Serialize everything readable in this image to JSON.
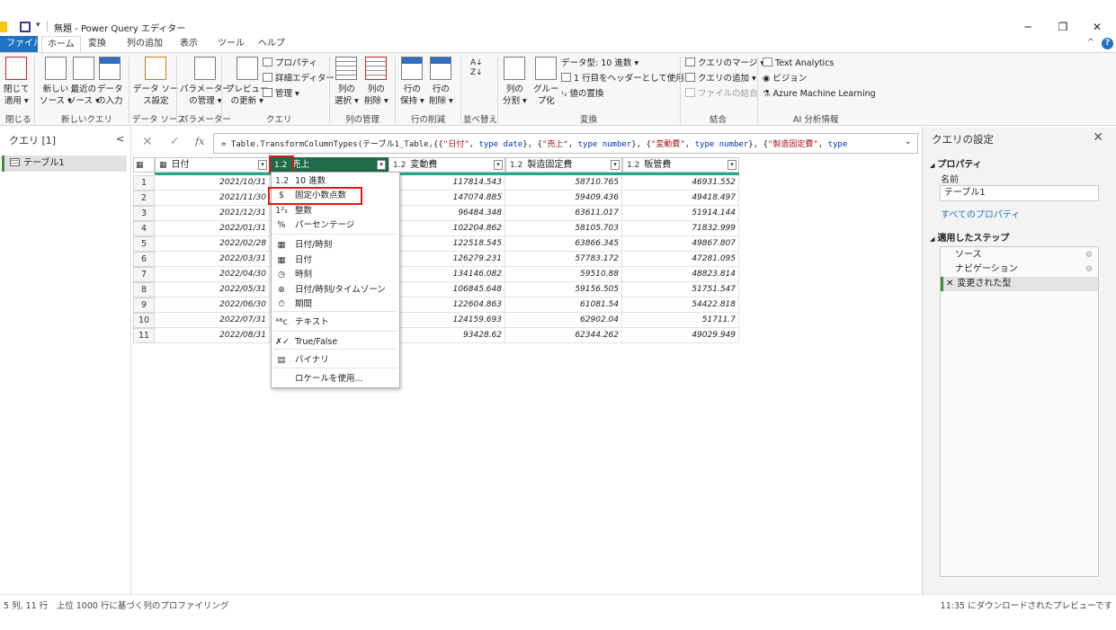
{
  "window": {
    "title": "無題 - Power Query エディター",
    "quick_access_dropdown": "▾",
    "minimize": "─",
    "restore": "❐",
    "close": "✕"
  },
  "menu": {
    "items": [
      "ファイル",
      "ホーム",
      "変換",
      "列の追加",
      "表示",
      "ツール",
      "ヘルプ"
    ],
    "active": "ホーム",
    "collapse_glyph": "^",
    "help_glyph": "?"
  },
  "ribbon": {
    "close_apply": [
      "閉じて",
      "適用 ▾"
    ],
    "new_source": [
      "新しい",
      "ソース ▾"
    ],
    "recent_sources": [
      "最近の",
      "ソース ▾"
    ],
    "enter_data": [
      "データ",
      "の入力"
    ],
    "data_source_settings": [
      "データ ソー",
      "ス設定"
    ],
    "manage_params": [
      "パラメーター",
      "の管理 ▾"
    ],
    "refresh_preview": [
      "プレビュー",
      "の更新 ▾"
    ],
    "properties": "プロパティ",
    "advanced_editor": "詳細エディター",
    "manage": "管理 ▾",
    "choose_cols": [
      "列の",
      "選択 ▾"
    ],
    "remove_cols": [
      "列の",
      "削除 ▾"
    ],
    "keep_rows": [
      "行の",
      "保持 ▾"
    ],
    "remove_rows": [
      "行の",
      "削除 ▾"
    ],
    "split_col": [
      "列の",
      "分割 ▾"
    ],
    "group_by": [
      "グルー",
      "プ化"
    ],
    "data_type": "データ型: 10 進数 ▾",
    "first_row_header": "1 行目をヘッダーとして使用 ▾",
    "replace_values": "値の置換",
    "merge_queries": "クエリのマージ ▾",
    "append_queries": "クエリの追加 ▾",
    "combine_files": "ファイルの結合",
    "text_analytics": "Text Analytics",
    "vision": "ビジョン",
    "azure_ml": "Azure Machine Learning",
    "groups": {
      "close": "閉じる",
      "new_query": "新しいクエリ",
      "data_source": "データ ソース",
      "parameters": "パラメーター",
      "query": "クエリ",
      "manage_cols": "列の管理",
      "reduce_rows": "行の削減",
      "sort": "並べ替え",
      "transform": "変換",
      "combine": "結合",
      "ai": "AI 分析情報"
    }
  },
  "queries_pane": {
    "header": "クエリ [1]",
    "collapse": "<",
    "items": [
      "テーブル1"
    ]
  },
  "formula_bar": {
    "cancel": "✕",
    "commit": "✓",
    "fx": "fx",
    "expand": "⌄",
    "prefix": "= Table.TransformColumnTypes(テーブル1_Table,{{",
    "s1": "\"日付\"",
    "mid1": ", ",
    "t1": "type date",
    "mid2": "}, {",
    "s2": "\"売上\"",
    "mid3": ", ",
    "t2": "type number",
    "mid4": "}, {",
    "s3": "\"変動費\"",
    "mid5": ", ",
    "t3": "type number",
    "mid6": "}, {",
    "s4": "\"製造固定費\"",
    "mid7": ", ",
    "t4": "type"
  },
  "table": {
    "corner_icon": "▦",
    "columns": [
      {
        "name": "日付",
        "type_icon": "▦"
      },
      {
        "name": "売上",
        "type_icon": "1.2"
      },
      {
        "name": "変動費",
        "type_icon": "1.2"
      },
      {
        "name": "製造固定費",
        "type_icon": "1.2"
      },
      {
        "name": "販管費",
        "type_icon": "1.2"
      }
    ],
    "rows": [
      {
        "n": "1",
        "date": "2021/10/31",
        "var": "117814.543",
        "fix": "58710.765",
        "sga": "46931.552"
      },
      {
        "n": "2",
        "date": "2021/11/30",
        "var": "147074.885",
        "fix": "59409.436",
        "sga": "49418.497"
      },
      {
        "n": "3",
        "date": "2021/12/31",
        "var": "96484.348",
        "fix": "63611.017",
        "sga": "51914.144"
      },
      {
        "n": "4",
        "date": "2022/01/31",
        "var": "102204.862",
        "fix": "58105.703",
        "sga": "71832.999"
      },
      {
        "n": "5",
        "date": "2022/02/28",
        "var": "122518.545",
        "fix": "63866.345",
        "sga": "49867.807"
      },
      {
        "n": "6",
        "date": "2022/03/31",
        "var": "126279.231",
        "fix": "57783.172",
        "sga": "47281.095"
      },
      {
        "n": "7",
        "date": "2022/04/30",
        "var": "134146.082",
        "fix": "59510.88",
        "sga": "48823.814"
      },
      {
        "n": "8",
        "date": "2022/05/31",
        "var": "106845.648",
        "fix": "59156.505",
        "sga": "51751.547"
      },
      {
        "n": "9",
        "date": "2022/06/30",
        "var": "122604.863",
        "fix": "61081.54",
        "sga": "54422.818"
      },
      {
        "n": "10",
        "date": "2022/07/31",
        "var": "124159.693",
        "fix": "62902.04",
        "sga": "51711.7"
      },
      {
        "n": "11",
        "date": "2022/08/31",
        "var": "93428.62",
        "fix": "62344.262",
        "sga": "49029.949"
      }
    ]
  },
  "type_menu": {
    "items": [
      {
        "icon": "1.2",
        "label": "10 進数"
      },
      {
        "icon": "$",
        "label": "固定小数点数"
      },
      {
        "icon": "1²₃",
        "label": "整数"
      },
      {
        "icon": "%",
        "label": "パーセンテージ"
      },
      {
        "icon": "▦",
        "label": "日付/時刻"
      },
      {
        "icon": "▦",
        "label": "日付"
      },
      {
        "icon": "◷",
        "label": "時刻"
      },
      {
        "icon": "⊕",
        "label": "日付/時刻/タイムゾーン"
      },
      {
        "icon": "⏱",
        "label": "期間"
      },
      {
        "icon": "ᴬᴮc",
        "label": "テキスト"
      },
      {
        "icon": "✗✓",
        "label": "True/False"
      },
      {
        "icon": "▤",
        "label": "バイナリ"
      },
      {
        "icon": "",
        "label": "ロケールを使用..."
      }
    ],
    "highlighted": "固定小数点数"
  },
  "settings_pane": {
    "title": "クエリの設定",
    "close": "✕",
    "properties_header": "プロパティ",
    "name_label": "名前",
    "name_value": "テーブル1",
    "all_properties": "すべてのプロパティ",
    "steps_header": "適用したステップ",
    "steps": [
      "ソース",
      "ナビゲーション",
      "変更された型"
    ],
    "gear": "⚙",
    "delete_step": "✕",
    "section_caret": "◢"
  },
  "status": {
    "left": "5 列, 11 行　上位 1000 行に基づく列のプロファイリング",
    "right": "11:35 にダウンロードされたプレビューです"
  },
  "colors": {
    "accent": "#1f73c2",
    "selected_header": "#1e6a49",
    "quality_bar": "#1faa8c",
    "highlight_box": "#e01818"
  }
}
